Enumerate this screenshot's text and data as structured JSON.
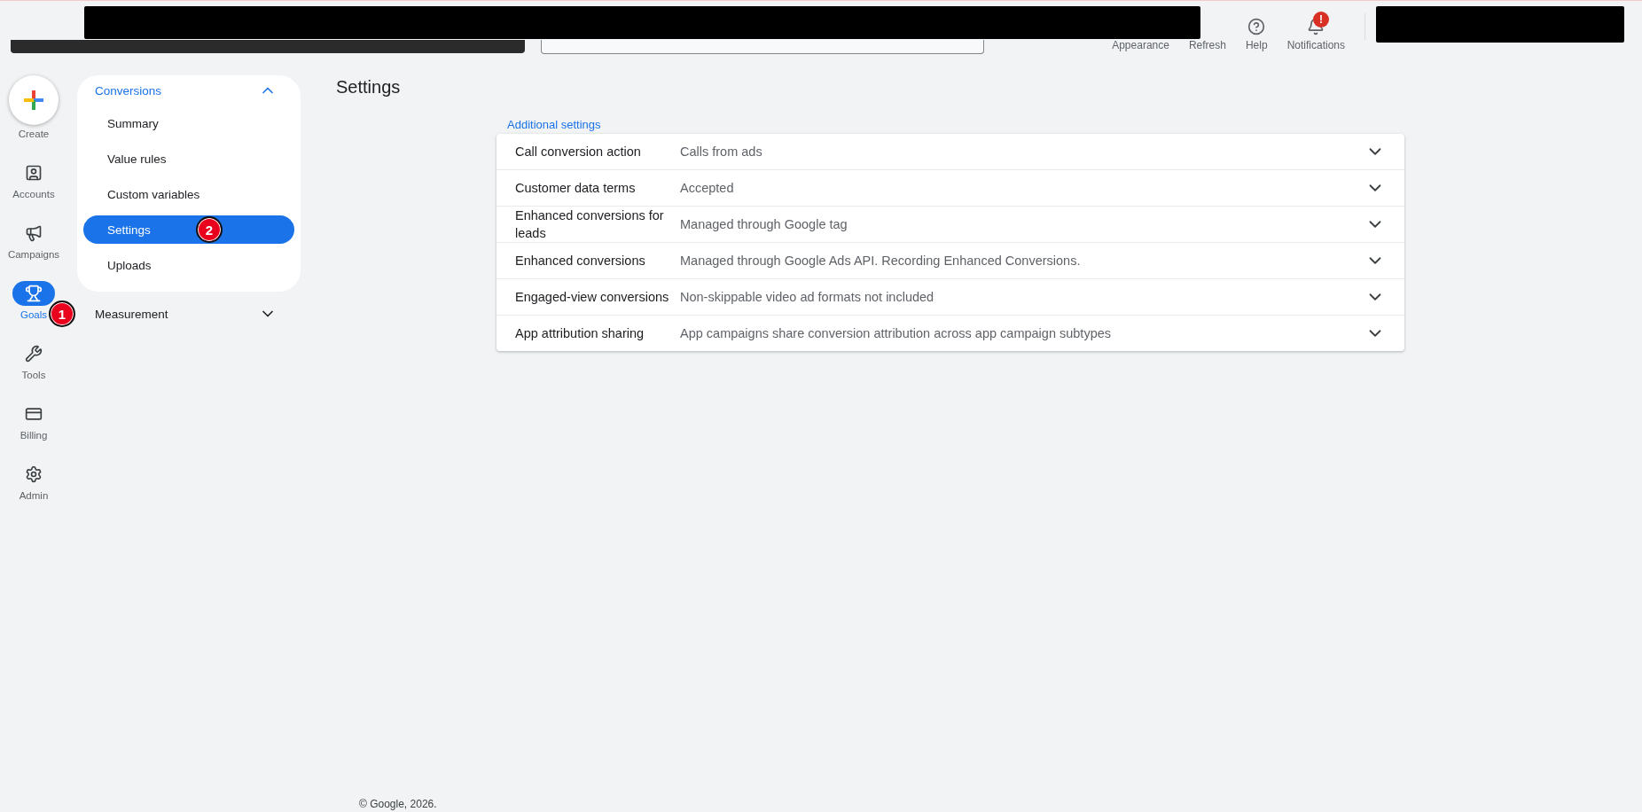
{
  "topbar": {
    "tools": [
      {
        "label": "Appearance",
        "kind": "text"
      },
      {
        "label": "Refresh",
        "kind": "text"
      },
      {
        "label": "Help",
        "kind": "icon"
      },
      {
        "label": "Notifications",
        "kind": "icon",
        "badge": "!"
      }
    ]
  },
  "rail": [
    {
      "label": "Create",
      "kind": "create"
    },
    {
      "label": "Accounts",
      "kind": "item",
      "selected": false
    },
    {
      "label": "Campaigns",
      "kind": "item",
      "selected": false
    },
    {
      "label": "Goals",
      "kind": "item",
      "selected": true,
      "step": "1"
    },
    {
      "label": "Tools",
      "kind": "item",
      "selected": false
    },
    {
      "label": "Billing",
      "kind": "item",
      "selected": false
    },
    {
      "label": "Admin",
      "kind": "item",
      "selected": false
    }
  ],
  "nav": [
    {
      "label": "Conversions",
      "expanded": true,
      "items": [
        {
          "label": "Summary",
          "selected": false
        },
        {
          "label": "Value rules",
          "selected": false
        },
        {
          "label": "Custom variables",
          "selected": false
        },
        {
          "label": "Settings",
          "selected": true,
          "step": "2"
        },
        {
          "label": "Uploads",
          "selected": false
        }
      ]
    },
    {
      "label": "Measurement",
      "expanded": false
    }
  ],
  "page": {
    "title": "Settings",
    "section": "Additional settings",
    "rows": [
      {
        "label": "Call conversion action",
        "value": "Calls from ads",
        "expanded": false
      },
      {
        "label": "Customer data terms",
        "value": "Accepted",
        "expanded": false
      },
      {
        "label": "Enhanced conversions for leads",
        "value": "Managed through Google tag",
        "expanded": false
      },
      {
        "label": "Enhanced conversions",
        "value": "Managed through Google Ads API. Recording Enhanced Conversions.",
        "expanded": false
      },
      {
        "label": "Engaged-view conversions",
        "value": "Non-skippable video ad formats not included",
        "expanded": false
      },
      {
        "label": "App attribution sharing",
        "value": "App campaigns share conversion attribution across app campaign subtypes",
        "expanded": false
      }
    ]
  },
  "footer": "© Google, 2026."
}
